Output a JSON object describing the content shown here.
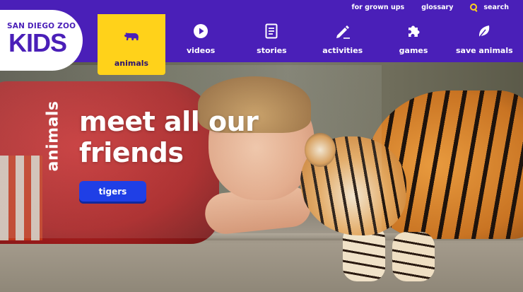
{
  "logo": {
    "top_text": "SAN DIEGO ZOO",
    "main_text": "KIDS"
  },
  "utility_nav": {
    "grown_ups": "for grown ups",
    "glossary": "glossary",
    "search": "search"
  },
  "nav": {
    "items": [
      {
        "label": "animals",
        "icon": "bear-icon",
        "active": true
      },
      {
        "label": "videos",
        "icon": "play-icon",
        "active": false
      },
      {
        "label": "stories",
        "icon": "document-icon",
        "active": false
      },
      {
        "label": "activities",
        "icon": "pencil-icon",
        "active": false
      },
      {
        "label": "games",
        "icon": "puzzle-icon",
        "active": false
      },
      {
        "label": "save animals",
        "icon": "leaf-icon",
        "active": false
      }
    ]
  },
  "hero": {
    "section_label": "animals",
    "headline": "meet all our friends",
    "button_label": "tigers"
  },
  "colors": {
    "brand_purple": "#4a1fb8",
    "accent_yellow": "#ffd21a",
    "button_blue": "#1f3fe6"
  }
}
